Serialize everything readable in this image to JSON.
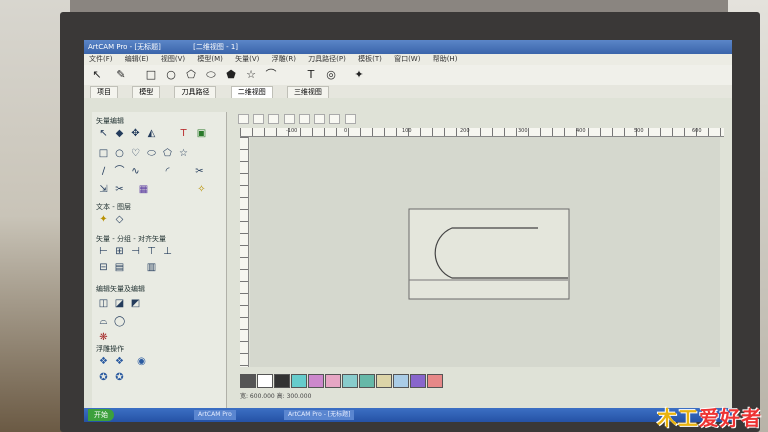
{
  "window": {
    "title": "ArtCAM Pro - [无标题]",
    "doc_tab": "[二维视图 - 1]"
  },
  "menu": [
    "文件(F)",
    "编辑(E)",
    "视图(V)",
    "模型(M)",
    "矢量(V)",
    "浮雕(R)",
    "刀具路径(P)",
    "模板(T)",
    "窗口(W)",
    "帮助(H)"
  ],
  "tabs": [
    "项目",
    "模型",
    "刀具路径",
    "二维视图",
    "三维视图"
  ],
  "active_tab": "二维视图",
  "panel": {
    "section1": "矢量编辑",
    "section2": "文本 - 图层",
    "section3": "矢量 - 分组 - 对齐矢量",
    "section4": "编辑矢量及编辑",
    "section5": "浮雕操作"
  },
  "ruler_marks": [
    "-100",
    "0",
    "100",
    "200",
    "300",
    "400",
    "500",
    "600"
  ],
  "palette": [
    "#555555",
    "#ffffff",
    "#333333",
    "#66cccc",
    "#cc88cc",
    "#e6a6c4",
    "#88cccc",
    "#66b8a8",
    "#dcd4a8",
    "#aacce6",
    "#8866cc",
    "#e68888"
  ],
  "status_text": "宽: 600.000 高: 300.000",
  "taskbar": {
    "start": "开始",
    "tasks": [
      "ArtCAM Pro",
      "ArtCAM Pro - [无标题]"
    ]
  },
  "watermark": {
    "part1": "木工",
    "part2": "爱好者"
  }
}
